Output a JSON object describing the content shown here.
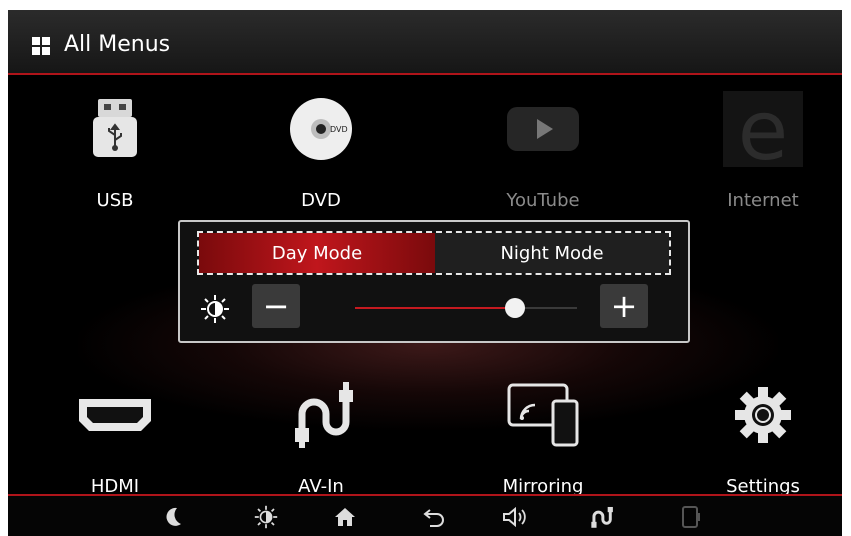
{
  "header": {
    "title": "All Menus",
    "icon": "grid-icon"
  },
  "menu": {
    "items": [
      {
        "label": "USB",
        "icon": "usb-icon",
        "enabled": true
      },
      {
        "label": "DVD",
        "icon": "dvd-icon",
        "enabled": true
      },
      {
        "label": "YouTube",
        "icon": "youtube-icon",
        "enabled": false
      },
      {
        "label": "Internet",
        "icon": "internet-icon",
        "enabled": false
      },
      {
        "label": "HDMI",
        "icon": "hdmi-icon",
        "enabled": true
      },
      {
        "label": "AV-In",
        "icon": "av-in-icon",
        "enabled": true
      },
      {
        "label": "Mirroring",
        "icon": "mirroring-icon",
        "enabled": true
      },
      {
        "label": "Settings",
        "icon": "gear-icon",
        "enabled": true
      }
    ]
  },
  "display_popup": {
    "day_mode_label": "Day Mode",
    "night_mode_label": "Night Mode",
    "selected_mode": "Day Mode",
    "minus_label": "−",
    "plus_label": "+",
    "brightness_level": 0.72
  },
  "bottom_bar": {
    "icons": [
      "moon-icon",
      "brightness-icon",
      "home-icon",
      "back-icon",
      "volume-icon",
      "av-in-icon",
      "phone-icon"
    ]
  },
  "colors": {
    "accent": "#c0161c",
    "background": "#000000",
    "disabled_text": "#8a8a8a"
  }
}
